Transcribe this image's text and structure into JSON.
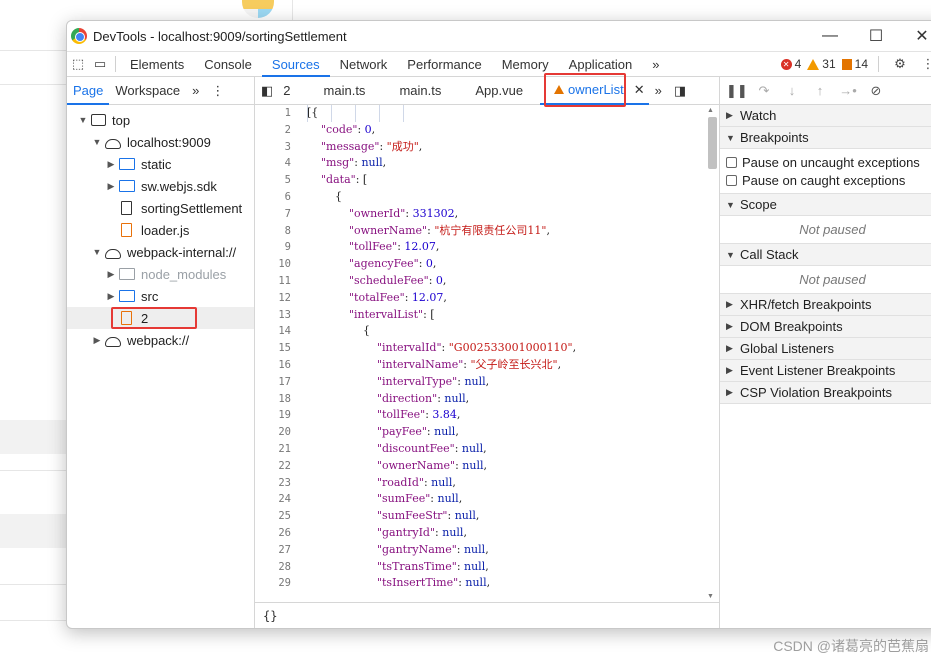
{
  "window": {
    "title": "DevTools - localhost:9009/sortingSettlement"
  },
  "toolbar": {
    "tabs": [
      "Elements",
      "Console",
      "Sources",
      "Network",
      "Performance",
      "Memory",
      "Application"
    ],
    "active": "Sources",
    "more": "»",
    "errors": "4",
    "warnings": "31",
    "issues": "14"
  },
  "navigator": {
    "tabs": [
      "Page",
      "Workspace"
    ],
    "more": "»",
    "tree": [
      {
        "label": "top",
        "depth": 0,
        "arrow": "▼",
        "icon": "window"
      },
      {
        "label": "localhost:9009",
        "depth": 1,
        "arrow": "▼",
        "icon": "cloud"
      },
      {
        "label": "static",
        "depth": 2,
        "arrow": "▶",
        "icon": "folder"
      },
      {
        "label": "sw.webjs.sdk",
        "depth": 2,
        "arrow": "▶",
        "icon": "folder"
      },
      {
        "label": "sortingSettlement",
        "depth": 2,
        "arrow": "",
        "icon": "file"
      },
      {
        "label": "loader.js",
        "depth": 2,
        "arrow": "",
        "icon": "file-orange"
      },
      {
        "label": "webpack-internal://",
        "depth": 1,
        "arrow": "▼",
        "icon": "cloud"
      },
      {
        "label": "node_modules",
        "depth": 2,
        "arrow": "▶",
        "icon": "folder-dim"
      },
      {
        "label": "src",
        "depth": 2,
        "arrow": "▶",
        "icon": "folder"
      },
      {
        "label": "2",
        "depth": 2,
        "arrow": "",
        "icon": "file-orange"
      },
      {
        "label": "webpack://",
        "depth": 1,
        "arrow": "▶",
        "icon": "cloud"
      }
    ]
  },
  "editor": {
    "tabs": [
      "2",
      "main.ts",
      "main.ts",
      "App.vue"
    ],
    "active_tab": "ownerList",
    "more": "»",
    "status": "{}"
  },
  "code_lines": [
    {
      "n": "1",
      "html": "<span class='p'>[{</span>"
    },
    {
      "n": "2",
      "html": "    <span class='k'>\"code\"</span><span class='p'>: </span><span class='n'>0</span><span class='p'>,</span>"
    },
    {
      "n": "3",
      "html": "    <span class='k'>\"message\"</span><span class='p'>: </span><span class='s'>\"成功\"</span><span class='p'>,</span>"
    },
    {
      "n": "4",
      "html": "    <span class='k'>\"msg\"</span><span class='p'>: </span><span class='kw'>null</span><span class='p'>,</span>"
    },
    {
      "n": "5",
      "html": "    <span class='k'>\"data\"</span><span class='p'>: [</span>"
    },
    {
      "n": "6",
      "html": "        <span class='p'>{</span>"
    },
    {
      "n": "7",
      "html": "            <span class='k'>\"ownerId\"</span><span class='p'>: </span><span class='n'>331302</span><span class='p'>,</span>"
    },
    {
      "n": "8",
      "html": "            <span class='k'>\"ownerName\"</span><span class='p'>: </span><span class='s'>\"杭宁有限责任公司11\"</span><span class='p'>,</span>"
    },
    {
      "n": "9",
      "html": "            <span class='k'>\"tollFee\"</span><span class='p'>: </span><span class='n'>12.07</span><span class='p'>,</span>"
    },
    {
      "n": "10",
      "html": "            <span class='k'>\"agencyFee\"</span><span class='p'>: </span><span class='n'>0</span><span class='p'>,</span>"
    },
    {
      "n": "11",
      "html": "            <span class='k'>\"scheduleFee\"</span><span class='p'>: </span><span class='n'>0</span><span class='p'>,</span>"
    },
    {
      "n": "12",
      "html": "            <span class='k'>\"totalFee\"</span><span class='p'>: </span><span class='n'>12.07</span><span class='p'>,</span>"
    },
    {
      "n": "13",
      "html": "            <span class='k'>\"intervalList\"</span><span class='p'>: [</span>"
    },
    {
      "n": "14",
      "html": "                <span class='p'>{</span>"
    },
    {
      "n": "15",
      "html": "                    <span class='k'>\"intervalId\"</span><span class='p'>: </span><span class='s'>\"G002533001000110\"</span><span class='p'>,</span>"
    },
    {
      "n": "16",
      "html": "                    <span class='k'>\"intervalName\"</span><span class='p'>: </span><span class='s'>\"父子岭至长兴北\"</span><span class='p'>,</span>"
    },
    {
      "n": "17",
      "html": "                    <span class='k'>\"intervalType\"</span><span class='p'>: </span><span class='kw'>null</span><span class='p'>,</span>"
    },
    {
      "n": "18",
      "html": "                    <span class='k'>\"direction\"</span><span class='p'>: </span><span class='kw'>null</span><span class='p'>,</span>"
    },
    {
      "n": "19",
      "html": "                    <span class='k'>\"tollFee\"</span><span class='p'>: </span><span class='n'>3.84</span><span class='p'>,</span>"
    },
    {
      "n": "20",
      "html": "                    <span class='k'>\"payFee\"</span><span class='p'>: </span><span class='kw'>null</span><span class='p'>,</span>"
    },
    {
      "n": "21",
      "html": "                    <span class='k'>\"discountFee\"</span><span class='p'>: </span><span class='kw'>null</span><span class='p'>,</span>"
    },
    {
      "n": "22",
      "html": "                    <span class='k'>\"ownerName\"</span><span class='p'>: </span><span class='kw'>null</span><span class='p'>,</span>"
    },
    {
      "n": "23",
      "html": "                    <span class='k'>\"roadId\"</span><span class='p'>: </span><span class='kw'>null</span><span class='p'>,</span>"
    },
    {
      "n": "24",
      "html": "                    <span class='k'>\"sumFee\"</span><span class='p'>: </span><span class='kw'>null</span><span class='p'>,</span>"
    },
    {
      "n": "25",
      "html": "                    <span class='k'>\"sumFeeStr\"</span><span class='p'>: </span><span class='kw'>null</span><span class='p'>,</span>"
    },
    {
      "n": "26",
      "html": "                    <span class='k'>\"gantryId\"</span><span class='p'>: </span><span class='kw'>null</span><span class='p'>,</span>"
    },
    {
      "n": "27",
      "html": "                    <span class='k'>\"gantryName\"</span><span class='p'>: </span><span class='kw'>null</span><span class='p'>,</span>"
    },
    {
      "n": "28",
      "html": "                    <span class='k'>\"tsTransTime\"</span><span class='p'>: </span><span class='kw'>null</span><span class='p'>,</span>"
    },
    {
      "n": "29",
      "html": "                    <span class='k'>\"tsInsertTime\"</span><span class='p'>: </span><span class='kw'>null</span><span class='p'>,</span>"
    }
  ],
  "debugger": {
    "watch": "Watch",
    "breakpoints": "Breakpoints",
    "pause_uncaught": "Pause on uncaught exceptions",
    "pause_caught": "Pause on caught exceptions",
    "scope": "Scope",
    "scope_status": "Not paused",
    "callstack": "Call Stack",
    "callstack_status": "Not paused",
    "sections": [
      "XHR/fetch Breakpoints",
      "DOM Breakpoints",
      "Global Listeners",
      "Event Listener Breakpoints",
      "CSP Violation Breakpoints"
    ]
  },
  "watermark": "CSDN @诸葛亮的芭蕉扇"
}
